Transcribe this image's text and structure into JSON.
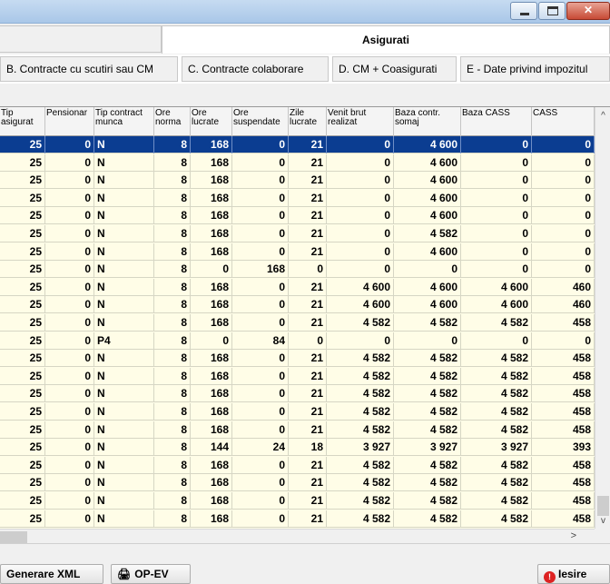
{
  "window": {
    "min_glyph": "",
    "max_glyph": "",
    "close_glyph": "✕"
  },
  "top_tabs": {
    "active_label": "Asigurati"
  },
  "sub_tabs": [
    "B. Contracte cu scutiri sau CM",
    "C. Contracte colaborare",
    "D. CM + Coasigurati",
    "E - Date privind impozitul"
  ],
  "grid": {
    "headers": [
      "Tip asigurat",
      "Pensionar",
      "Tip contract munca",
      "Ore norma",
      "Ore lucrate",
      "Ore suspendate",
      "Zile lucrate",
      "Venit brut realizat",
      "Baza contr. somaj",
      "Baza CASS",
      "CASS"
    ],
    "rows": [
      [
        "25",
        "0",
        "N",
        "8",
        "168",
        "0",
        "21",
        "0",
        "4 600",
        "0",
        "0"
      ],
      [
        "25",
        "0",
        "N",
        "8",
        "168",
        "0",
        "21",
        "0",
        "4 600",
        "0",
        "0"
      ],
      [
        "25",
        "0",
        "N",
        "8",
        "168",
        "0",
        "21",
        "0",
        "4 600",
        "0",
        "0"
      ],
      [
        "25",
        "0",
        "N",
        "8",
        "168",
        "0",
        "21",
        "0",
        "4 600",
        "0",
        "0"
      ],
      [
        "25",
        "0",
        "N",
        "8",
        "168",
        "0",
        "21",
        "0",
        "4 600",
        "0",
        "0"
      ],
      [
        "25",
        "0",
        "N",
        "8",
        "168",
        "0",
        "21",
        "0",
        "4 582",
        "0",
        "0"
      ],
      [
        "25",
        "0",
        "N",
        "8",
        "168",
        "0",
        "21",
        "0",
        "4 600",
        "0",
        "0"
      ],
      [
        "25",
        "0",
        "N",
        "8",
        "0",
        "168",
        "0",
        "0",
        "0",
        "0",
        "0"
      ],
      [
        "25",
        "0",
        "N",
        "8",
        "168",
        "0",
        "21",
        "4 600",
        "4 600",
        "4 600",
        "460"
      ],
      [
        "25",
        "0",
        "N",
        "8",
        "168",
        "0",
        "21",
        "4 600",
        "4 600",
        "4 600",
        "460"
      ],
      [
        "25",
        "0",
        "N",
        "8",
        "168",
        "0",
        "21",
        "4 582",
        "4 582",
        "4 582",
        "458"
      ],
      [
        "25",
        "0",
        "P4",
        "8",
        "0",
        "84",
        "0",
        "0",
        "0",
        "0",
        "0"
      ],
      [
        "25",
        "0",
        "N",
        "8",
        "168",
        "0",
        "21",
        "4 582",
        "4 582",
        "4 582",
        "458"
      ],
      [
        "25",
        "0",
        "N",
        "8",
        "168",
        "0",
        "21",
        "4 582",
        "4 582",
        "4 582",
        "458"
      ],
      [
        "25",
        "0",
        "N",
        "8",
        "168",
        "0",
        "21",
        "4 582",
        "4 582",
        "4 582",
        "458"
      ],
      [
        "25",
        "0",
        "N",
        "8",
        "168",
        "0",
        "21",
        "4 582",
        "4 582",
        "4 582",
        "458"
      ],
      [
        "25",
        "0",
        "N",
        "8",
        "168",
        "0",
        "21",
        "4 582",
        "4 582",
        "4 582",
        "458"
      ],
      [
        "25",
        "0",
        "N",
        "8",
        "144",
        "24",
        "18",
        "3 927",
        "3 927",
        "3 927",
        "393"
      ],
      [
        "25",
        "0",
        "N",
        "8",
        "168",
        "0",
        "21",
        "4 582",
        "4 582",
        "4 582",
        "458"
      ],
      [
        "25",
        "0",
        "N",
        "8",
        "168",
        "0",
        "21",
        "4 582",
        "4 582",
        "4 582",
        "458"
      ],
      [
        "25",
        "0",
        "N",
        "8",
        "168",
        "0",
        "21",
        "4 582",
        "4 582",
        "4 582",
        "458"
      ],
      [
        "25",
        "0",
        "N",
        "8",
        "168",
        "0",
        "21",
        "4 582",
        "4 582",
        "4 582",
        "458"
      ]
    ],
    "selected_row": 0
  },
  "scroll": {
    "up": "^",
    "down": "v",
    "right": ">"
  },
  "footer": {
    "xml_label": "Generare XML",
    "opev_label": "OP-EV",
    "opev_icon": "🖨",
    "exit_label": "Iesire",
    "exit_icon": "!"
  },
  "colors": {
    "selection": "#0b3d91",
    "grid_bg": "#fffde7"
  }
}
